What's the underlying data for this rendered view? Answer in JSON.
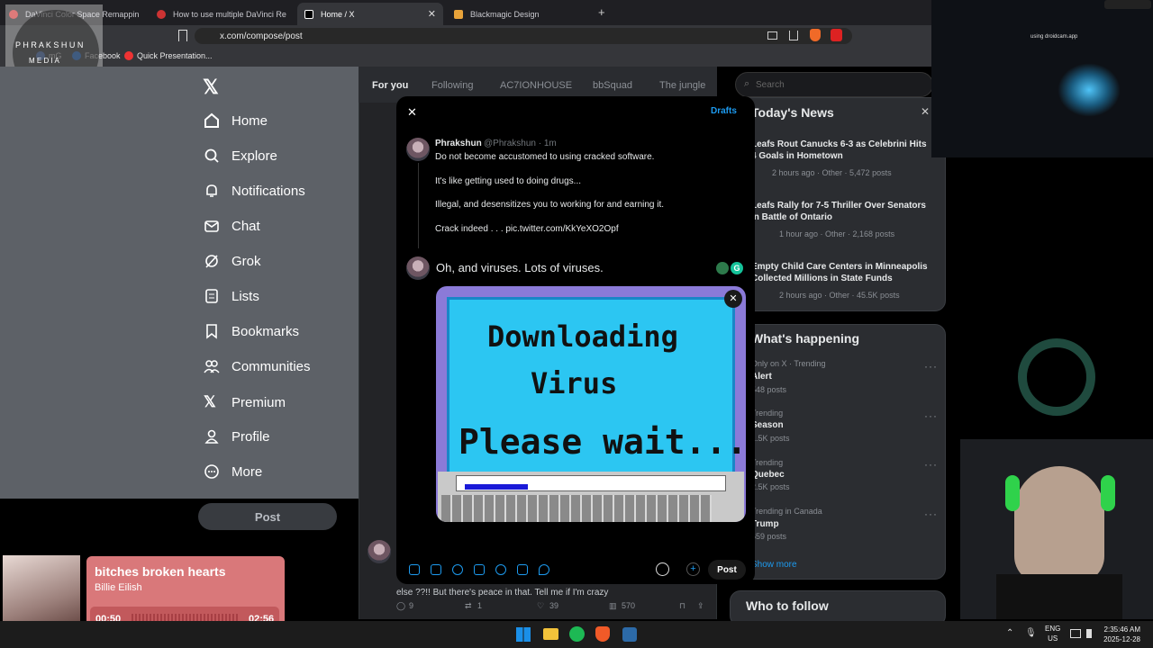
{
  "browser": {
    "tabs": [
      {
        "title": "DaVinci Color Space Remapping - Bu",
        "active": false
      },
      {
        "title": "How to use multiple DaVinci Resolve",
        "active": false
      },
      {
        "title": "Home / X",
        "active": true
      },
      {
        "title": "Blackmagic Design",
        "active": false
      }
    ],
    "new_tab": "+",
    "url": "x.com/compose/post",
    "bookmarks": [
      "mG",
      "Facebook",
      "Quick Presentation..."
    ]
  },
  "watermark": {
    "text_top": "P H R A K S H U N",
    "text_bottom": "M E D I A"
  },
  "nav": {
    "items": [
      "Home",
      "Explore",
      "Notifications",
      "Chat",
      "Grok",
      "Lists",
      "Bookmarks",
      "Communities",
      "Premium",
      "Profile",
      "More"
    ],
    "post_button": "Post"
  },
  "timeline_tabs": [
    "For you",
    "Following",
    "AC7IONHOUSE",
    "bbSquad",
    "The jungle"
  ],
  "search": {
    "placeholder": "Search"
  },
  "news": {
    "title": "Today's News",
    "items": [
      {
        "headline": "Leafs Rout Canucks 6-3 as Celebrini Hits 4 Goals in Hometown",
        "meta": "2 hours ago · Other · 5,472 posts"
      },
      {
        "headline": "Leafs Rally for 7-5 Thriller Over Senators in Battle of Ontario",
        "meta": "1 hour ago · Other · 2,168 posts"
      },
      {
        "headline": "Empty Child Care Centers in Minneapolis Collected Millions in State Funds",
        "meta": "2 hours ago · Other · 45.5K posts"
      }
    ]
  },
  "happening": {
    "title": "What's happening",
    "items": [
      {
        "context": "Only on X · Trending",
        "name": "Alert",
        "posts": "548 posts"
      },
      {
        "context": "Trending",
        "name": "Season",
        "posts": "1.5K posts"
      },
      {
        "context": "Trending",
        "name": "Quebec",
        "posts": "2.5K posts"
      },
      {
        "context": "Trending in Canada",
        "name": "Trump",
        "posts": "659 posts"
      }
    ],
    "show_more": "Show more"
  },
  "who_to_follow": "Who to follow",
  "compose": {
    "drafts": "Drafts",
    "quoted": {
      "name": "Phrakshun",
      "handle": "@Phrakshun · 1m",
      "lines": [
        "Do not become accustomed to using cracked software.",
        "It's like getting used to doing drugs...",
        "Illegal, and desensitizes you to working for and earning it.",
        "Crack indeed . . . pic.twitter.com/KkYeXO2Opf"
      ]
    },
    "draft_text": "Oh, and viruses. Lots of viruses.",
    "media_lines": [
      "Downloading",
      "Virus",
      "Please wait..."
    ],
    "post_button": "Post"
  },
  "background_tweet": {
    "text": "else ??!! But there's peace in that. Tell me if I'm crazy",
    "actions": {
      "replies": "9",
      "reposts": "1",
      "likes": "39",
      "views": "570"
    }
  },
  "music": {
    "title": "bitches broken hearts",
    "artist": "Billie Eilish",
    "elapsed": "00:50",
    "duration": "02:56",
    "progress": 0.28
  },
  "camera_overlay_text": "using droidcam.app",
  "tray": {
    "lang": "ENG",
    "region": "US",
    "time": "2:35:46 AM",
    "date": "2025-12-28"
  },
  "colors": {
    "accent": "#1d9bf0",
    "music_bg": "#d9787a",
    "virus_screen": "#2cc6f2"
  }
}
